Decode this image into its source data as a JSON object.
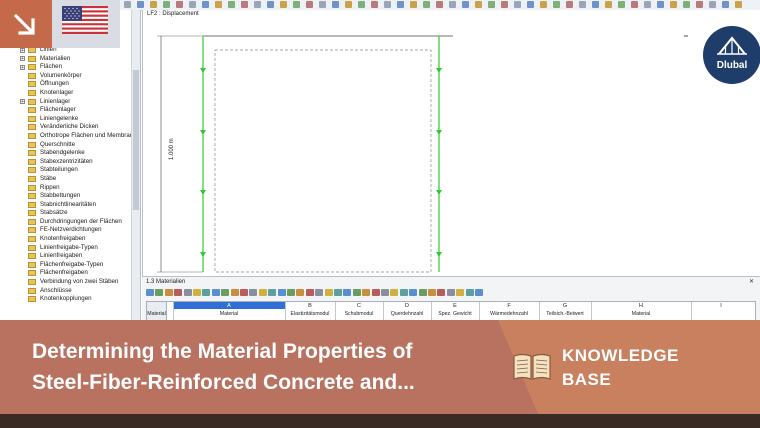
{
  "toolbar": {
    "icon_count": 48
  },
  "navigator": {
    "items": [
      {
        "label": "Linien",
        "expandable": true
      },
      {
        "label": "Materialien",
        "expandable": true
      },
      {
        "label": "Flächen",
        "expandable": true
      },
      {
        "label": "Volumenkörper",
        "expandable": false
      },
      {
        "label": "Öffnungen",
        "expandable": false
      },
      {
        "label": "Knotenlager",
        "expandable": false
      },
      {
        "label": "Linienlager",
        "expandable": true
      },
      {
        "label": "Flächenlager",
        "expandable": false
      },
      {
        "label": "Liniengelenke",
        "expandable": false
      },
      {
        "label": "Veränderliche Dicken",
        "expandable": false
      },
      {
        "label": "Orthotrope Flächen und Membran",
        "expandable": false
      },
      {
        "label": "Querschnitte",
        "expandable": false
      },
      {
        "label": "Stabendgelenke",
        "expandable": false
      },
      {
        "label": "Stabexzentrizitäten",
        "expandable": false
      },
      {
        "label": "Stabteilungen",
        "expandable": false
      },
      {
        "label": "Stäbe",
        "expandable": false
      },
      {
        "label": "Rippen",
        "expandable": false
      },
      {
        "label": "Stabbettungen",
        "expandable": false
      },
      {
        "label": "Stabnichtlinearitäten",
        "expandable": false
      },
      {
        "label": "Stabsätze",
        "expandable": false
      },
      {
        "label": "Durchdringungen der Flächen",
        "expandable": false
      },
      {
        "label": "FE-Netzverdichtungen",
        "expandable": false
      },
      {
        "label": "Knotenfreigaben",
        "expandable": false
      },
      {
        "label": "Linienfreigabe-Typen",
        "expandable": false
      },
      {
        "label": "Linienfreigaben",
        "expandable": false
      },
      {
        "label": "Flächenfreigabe-Typen",
        "expandable": false
      },
      {
        "label": "Flächenfreigaben",
        "expandable": false
      },
      {
        "label": "Verbindung von zwei Stäben",
        "expandable": false
      },
      {
        "label": "Anschlüsse",
        "expandable": false
      },
      {
        "label": "Knotenkopplungen",
        "expandable": false
      }
    ]
  },
  "viewport": {
    "title": "LF2 : Displacement",
    "dimension_label": "1.000 m"
  },
  "panel": {
    "title": "1.3 Materialien",
    "close": "✕",
    "columns": [
      {
        "letter": "A",
        "label": "Material"
      },
      {
        "letter": "B",
        "label": "Elastizitätsmodul"
      },
      {
        "letter": "C",
        "label": "Schubmodul"
      },
      {
        "letter": "D",
        "label": "Querdehnzahl"
      },
      {
        "letter": "E",
        "label": "Spez. Gewicht"
      },
      {
        "letter": "F",
        "label": "Wärmedehnzahl"
      },
      {
        "letter": "G",
        "label": "Teilsich.-Beiwert"
      },
      {
        "letter": "H",
        "label": "Material"
      },
      {
        "letter": "I",
        "label": ""
      }
    ],
    "row_header": "Material"
  },
  "logo": {
    "text": "Dlubal"
  },
  "banner": {
    "headline_line1": "Determining the Material Properties of",
    "headline_line2": "Steel-Fiber-Reinforced Concrete and...",
    "kb_line1": "KNOWLEDGE",
    "kb_line2": "BASE"
  },
  "colors": {
    "banner": "#b97160",
    "arrow_box": "#c46a4a",
    "logo": "#1e3d6b",
    "model_lines": "#32c832"
  }
}
